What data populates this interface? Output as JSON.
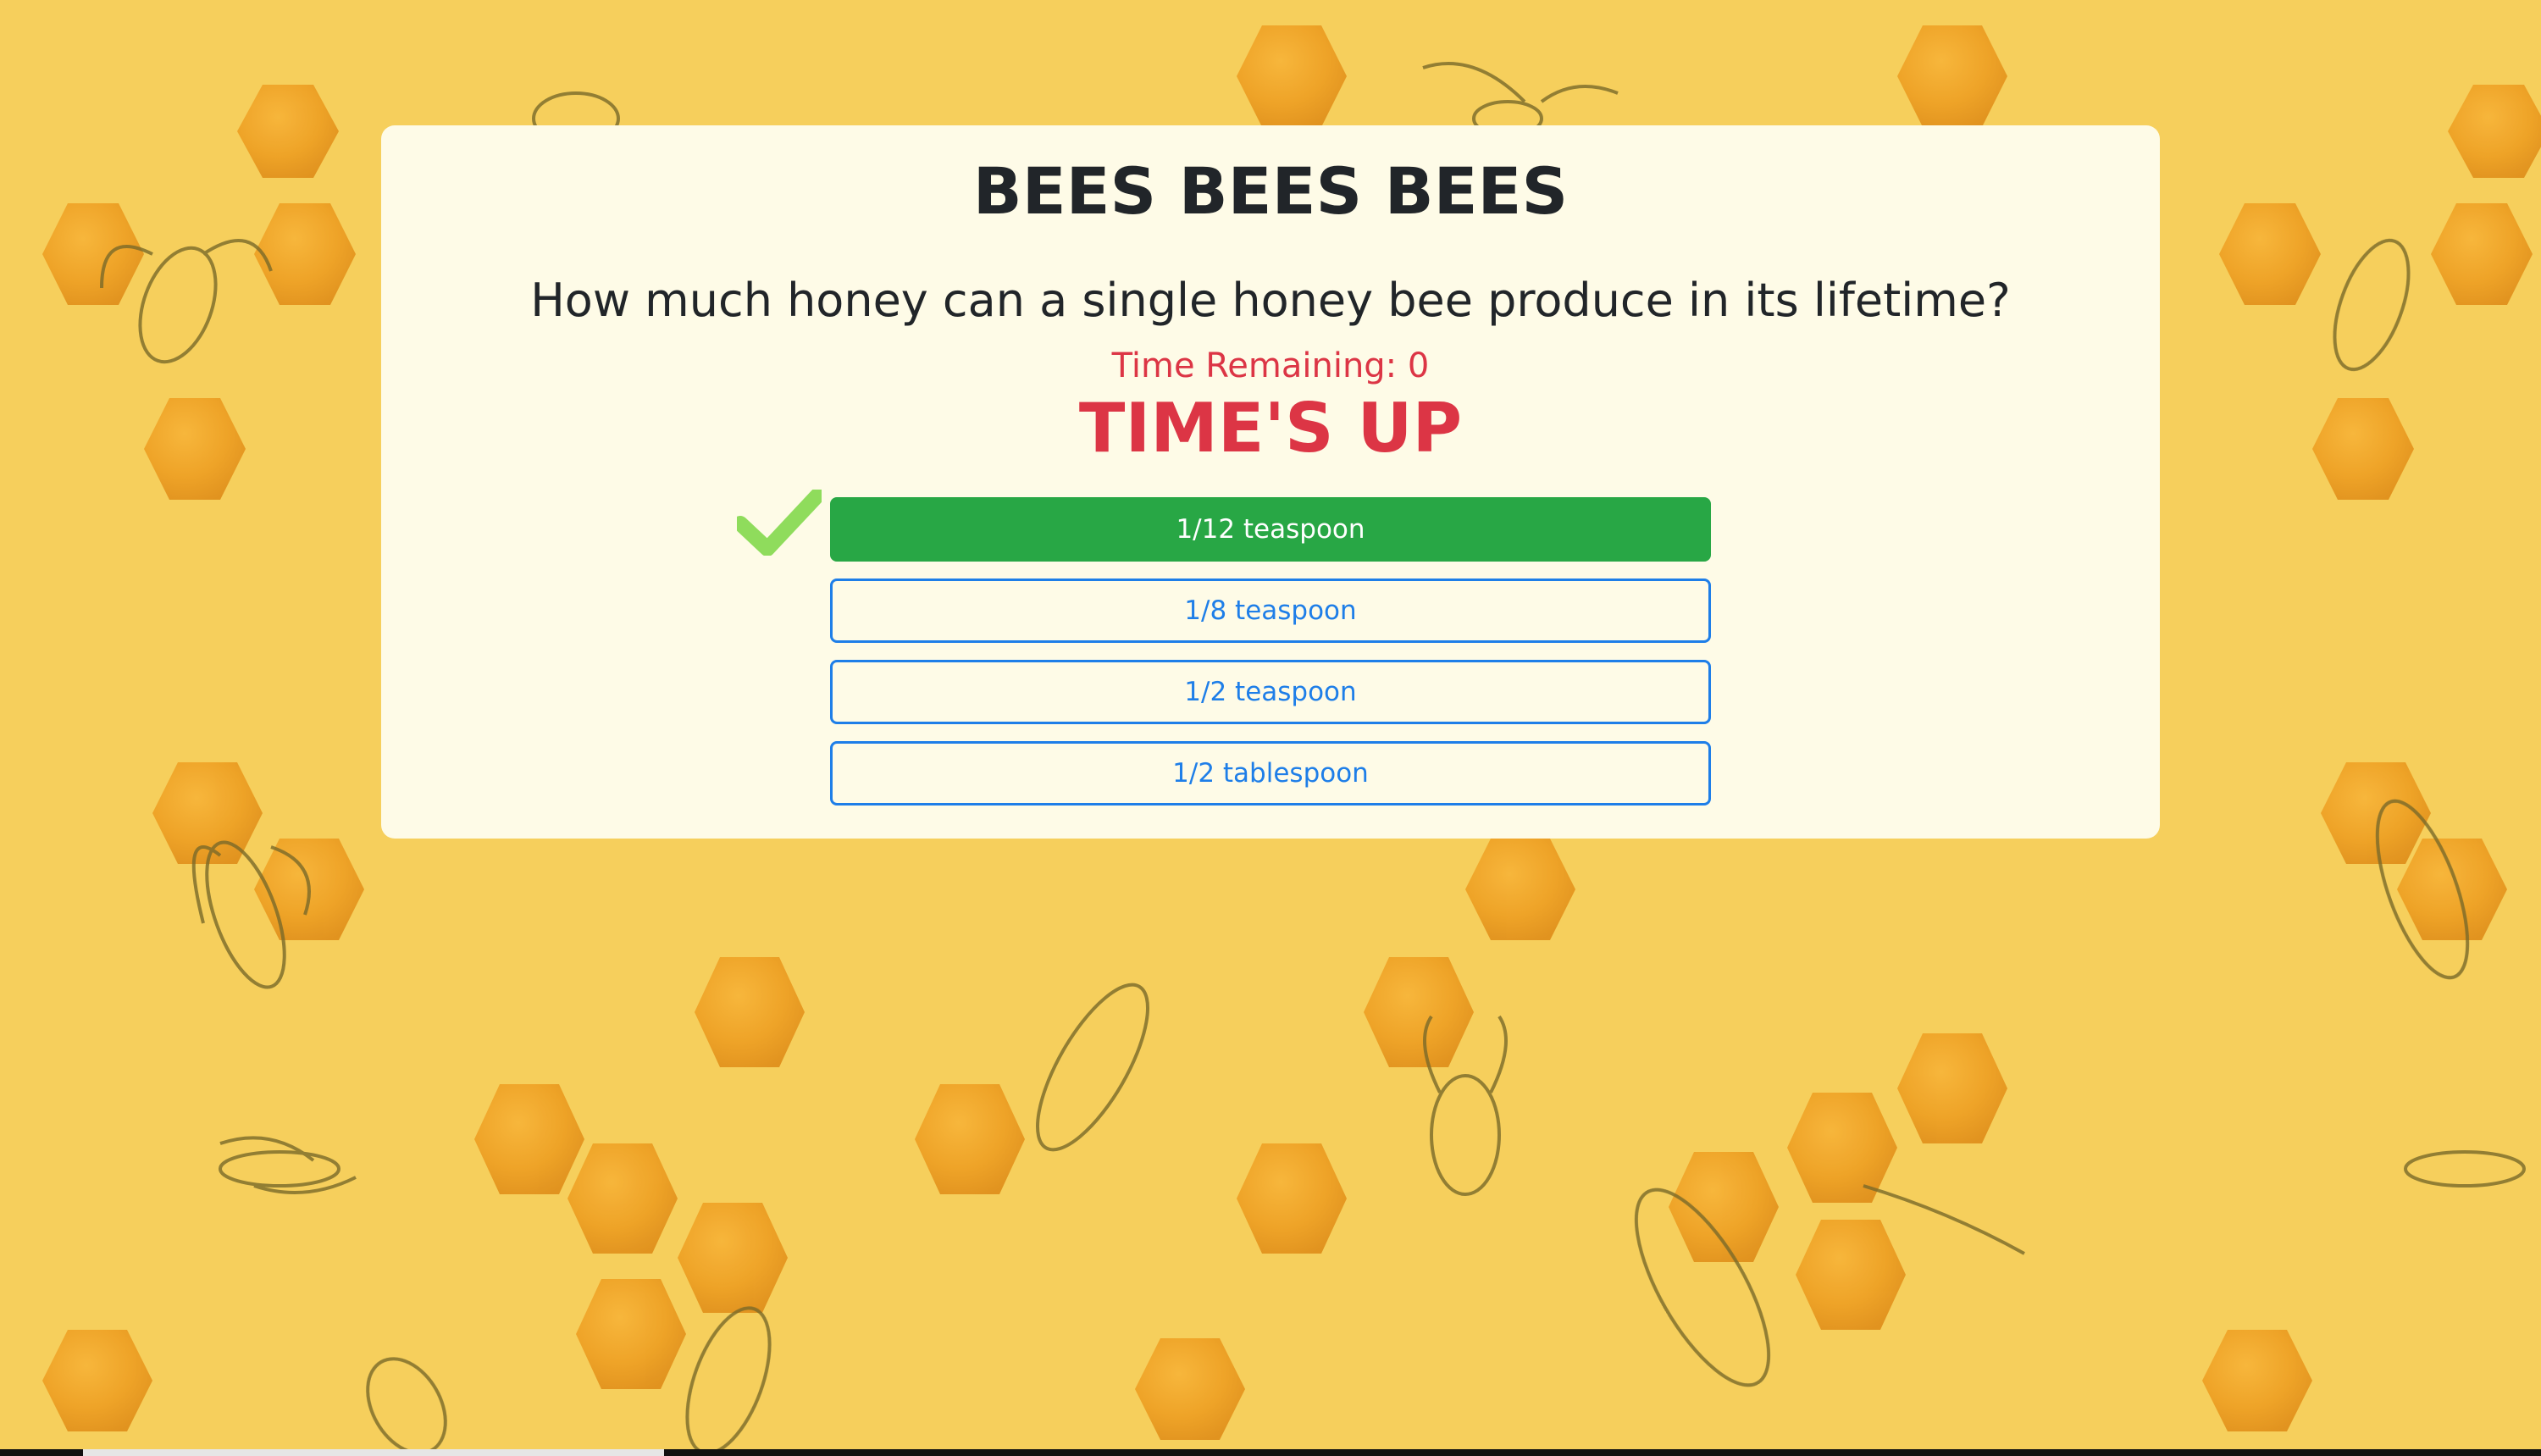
{
  "quiz": {
    "title": "BEES BEES BEES",
    "question": "How much honey can a single honey bee produce in its lifetime?",
    "timer_text": "Time Remaining: 0",
    "status_text": "TIME'S UP",
    "answers": [
      {
        "label": "1/12 teaspoon",
        "correct": true
      },
      {
        "label": "1/8 teaspoon",
        "correct": false
      },
      {
        "label": "1/2 teaspoon",
        "correct": false
      },
      {
        "label": "1/2 tablespoon",
        "correct": false
      }
    ]
  },
  "icons": {
    "correct_marker": "checkmark-icon"
  },
  "colors": {
    "background": "#f6cf5c",
    "card": "#fefbe7",
    "danger": "#dc3545",
    "correct": "#28a745",
    "outline": "#1e7ee8",
    "check": "#8fdc5c",
    "honeycomb": "#f0a424"
  }
}
